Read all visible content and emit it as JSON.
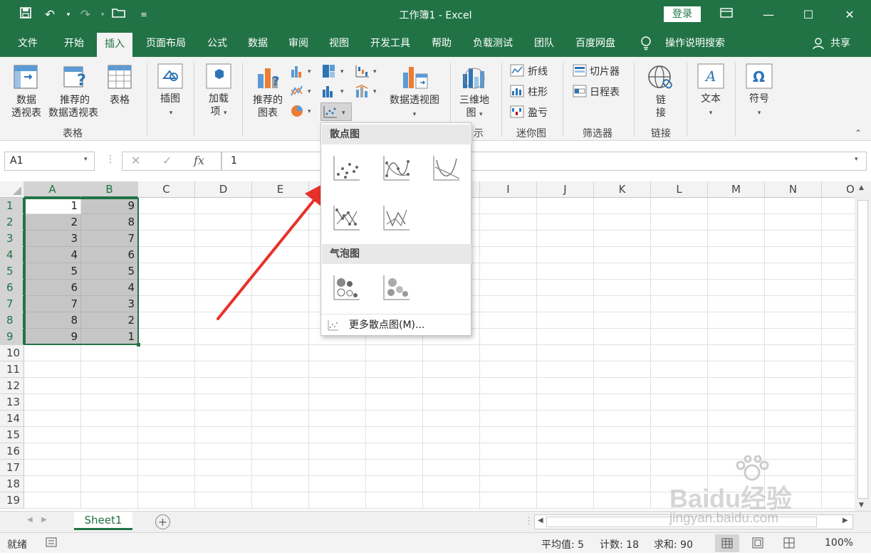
{
  "titlebar": {
    "title": "工作簿1 - Excel",
    "login": "登录",
    "accent": "#217346"
  },
  "tabs": [
    "文件",
    "开始",
    "插入",
    "页面布局",
    "公式",
    "数据",
    "审阅",
    "视图",
    "开发工具",
    "帮助",
    "负载测试",
    "团队",
    "百度网盘"
  ],
  "tell_me": "操作说明搜索",
  "share": "共享",
  "ribbon": {
    "pivot_table_1": "数据",
    "pivot_table_2": "透视表",
    "recommended_pivot_1": "推荐的",
    "recommended_pivot_2": "数据透视表",
    "table": "表格",
    "group_tables": "表格",
    "illustrations": "插图",
    "addins_1": "加载",
    "addins_2": "项",
    "recommended_charts_1": "推荐的",
    "recommended_charts_2": "图表",
    "pivot_chart": "数据透视图",
    "map3d_1": "三维地",
    "map3d_2": "图",
    "group_tour": "示",
    "spark_line": "折线",
    "spark_column": "柱形",
    "spark_winloss": "盈亏",
    "group_sparklines": "迷你图",
    "slicer": "切片器",
    "timeline": "日程表",
    "group_filters": "筛选器",
    "link_1": "链",
    "link_2": "接",
    "group_links": "链接",
    "text": "文本",
    "symbol": "符号"
  },
  "formula_bar": {
    "name_box": "A1",
    "fx": "fx",
    "value": "1"
  },
  "columns": [
    "A",
    "B",
    "C",
    "D",
    "E",
    "F",
    "G",
    "H",
    "I",
    "J",
    "K",
    "L",
    "M",
    "N",
    "O"
  ],
  "rows": [
    "1",
    "2",
    "3",
    "4",
    "5",
    "6",
    "7",
    "8",
    "9",
    "10",
    "11",
    "12",
    "13",
    "14",
    "15",
    "16",
    "17",
    "18",
    "19"
  ],
  "data_a": [
    "1",
    "2",
    "3",
    "4",
    "5",
    "6",
    "7",
    "8",
    "9"
  ],
  "data_b": [
    "9",
    "8",
    "7",
    "6",
    "5",
    "4",
    "3",
    "2",
    "1"
  ],
  "dropdown": {
    "scatter_header": "散点图",
    "bubble_header": "气泡图",
    "more": "更多散点图(M)..."
  },
  "sheet_tab": "Sheet1",
  "status": {
    "ready": "就绪",
    "average": "平均值: 5",
    "count": "计数: 18",
    "sum": "求和: 90",
    "zoom": "100%"
  },
  "watermark": {
    "brand": "Baidu经验",
    "url": "jingyan.baidu.com"
  }
}
